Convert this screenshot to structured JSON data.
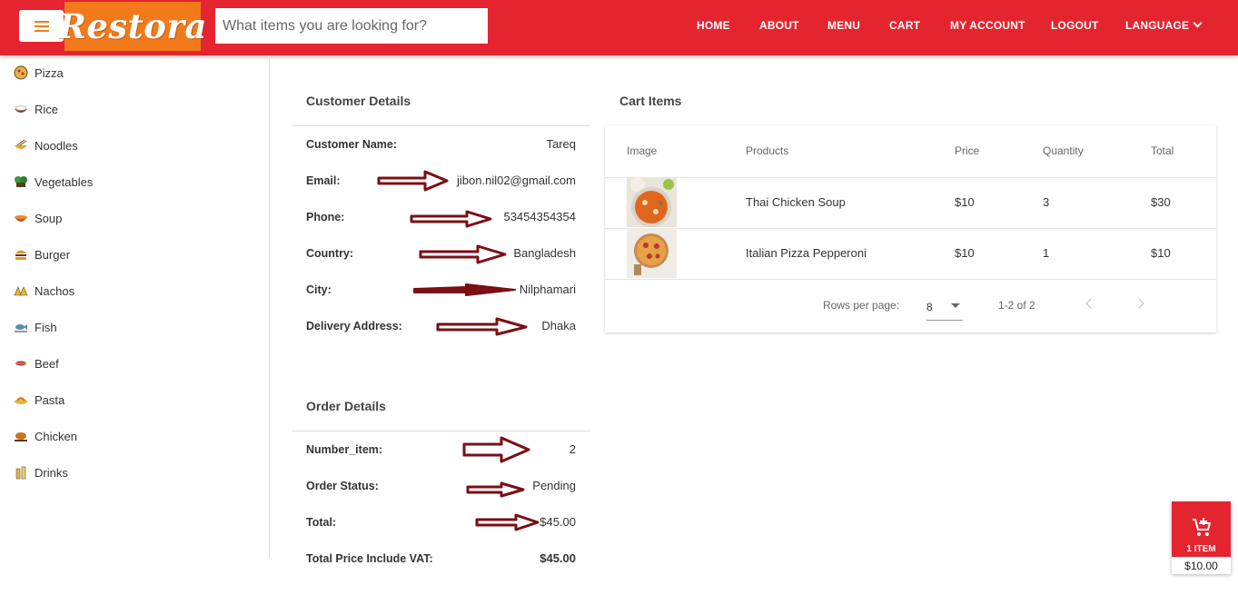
{
  "header": {
    "logo_text": "Restora",
    "search_placeholder": "What items you are looking for?",
    "nav": [
      "HOME",
      "ABOUT",
      "MENU",
      "CART",
      "MY ACCOUNT",
      "LOGOUT",
      "LANGUAGE"
    ],
    "colors": {
      "primary": "#e42530",
      "logo_bg": "#f27a1a"
    }
  },
  "sidebar": {
    "categories": [
      {
        "label": "Pizza",
        "icon": "pizza-icon"
      },
      {
        "label": "Rice",
        "icon": "rice-icon"
      },
      {
        "label": "Noodles",
        "icon": "noodles-icon"
      },
      {
        "label": "Vegetables",
        "icon": "vegetables-icon"
      },
      {
        "label": "Soup",
        "icon": "soup-icon"
      },
      {
        "label": "Burger",
        "icon": "burger-icon"
      },
      {
        "label": "Nachos",
        "icon": "nachos-icon"
      },
      {
        "label": "Fish",
        "icon": "fish-icon"
      },
      {
        "label": "Beef",
        "icon": "beef-icon"
      },
      {
        "label": "Pasta",
        "icon": "pasta-icon"
      },
      {
        "label": "Chicken",
        "icon": "chicken-icon"
      },
      {
        "label": "Drinks",
        "icon": "drinks-icon"
      }
    ]
  },
  "customer": {
    "title": "Customer Details",
    "rows": [
      {
        "label": "Customer Name:",
        "value": "Tareq"
      },
      {
        "label": "Email:",
        "value": "jibon.nil02@gmail.com"
      },
      {
        "label": "Phone:",
        "value": "53454354354"
      },
      {
        "label": "Country:",
        "value": "Bangladesh"
      },
      {
        "label": "City:",
        "value": "Nilphamari"
      },
      {
        "label": "Delivery Address:",
        "value": "Dhaka"
      }
    ]
  },
  "order": {
    "title": "Order Details",
    "rows": [
      {
        "label": "Number_item:",
        "value": "2"
      },
      {
        "label": "Order Status:",
        "value": "Pending"
      },
      {
        "label": "Total:",
        "value": "$45.00"
      },
      {
        "label": "Total Price Include VAT:",
        "value": "$45.00"
      }
    ]
  },
  "cart": {
    "title": "Cart Items",
    "columns": [
      "Image",
      "Products",
      "Price",
      "Quantity",
      "Total"
    ],
    "items": [
      {
        "product": "Thai Chicken Soup",
        "price": "$10",
        "quantity": "3",
        "total": "$30",
        "image": "soup-image"
      },
      {
        "product": "Italian Pizza Pepperoni",
        "price": "$10",
        "quantity": "1",
        "total": "$10",
        "image": "pizza-image"
      }
    ],
    "rows_per_page_label": "Rows per page:",
    "rows_per_page": "8",
    "range": "1-2 of 2"
  },
  "floating_cart": {
    "count": "1 ITEM",
    "price": "$10.00"
  }
}
